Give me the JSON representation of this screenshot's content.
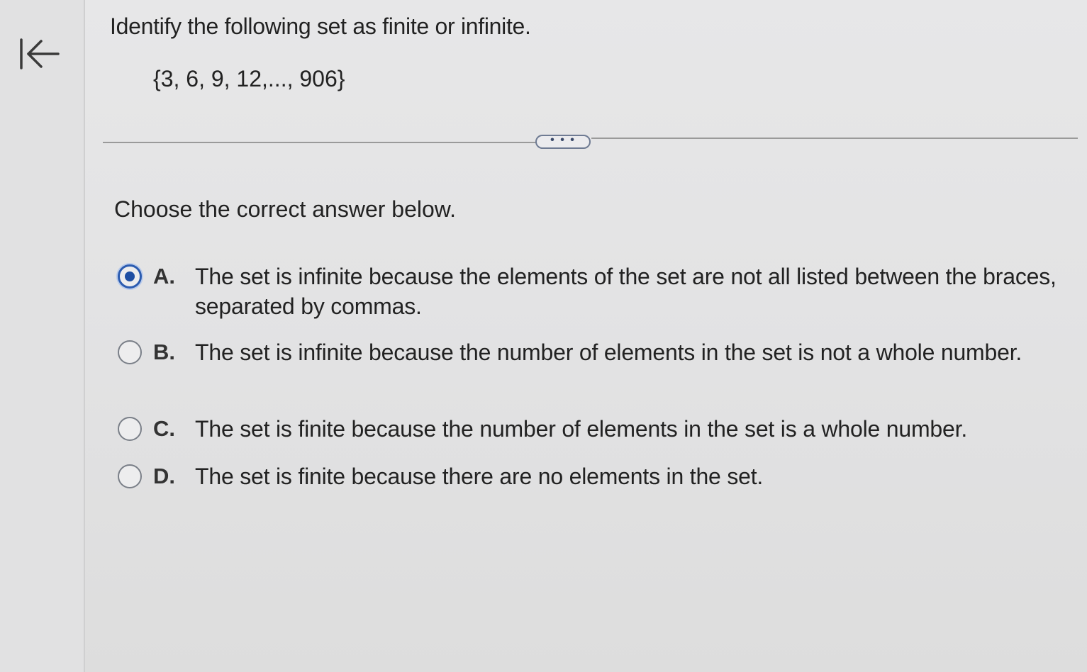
{
  "question": {
    "title": "Identify the following set as finite or infinite.",
    "set_expression": "{3, 6, 9, 12,..., 906}"
  },
  "expand_button": {
    "label": "• • •"
  },
  "instruction": "Choose the correct answer below.",
  "options": [
    {
      "letter": "A.",
      "text": "The set is infinite because the elements of the set are not all listed between the braces, separated by commas.",
      "selected": true
    },
    {
      "letter": "B.",
      "text": "The set is infinite because the number of elements in the set is not a whole number.",
      "selected": false
    },
    {
      "letter": "C.",
      "text": "The set is finite because the number of elements in the set is a whole number.",
      "selected": false
    },
    {
      "letter": "D.",
      "text": "The set is finite because there are no elements in the set.",
      "selected": false
    }
  ],
  "icons": {
    "back": "back-to-start-arrow-icon"
  },
  "colors": {
    "selected_radio": "#1f4fa3",
    "unselected_radio": "#7a7f88",
    "divider": "#9a9a9a"
  }
}
